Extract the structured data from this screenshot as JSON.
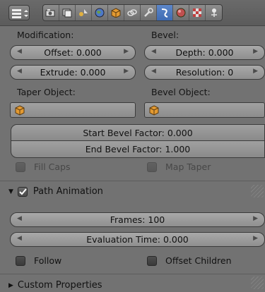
{
  "header": {
    "tabs": [
      "render-icon",
      "render-layers-icon",
      "scene-icon",
      "world-icon",
      "object-icon",
      "constraints-icon",
      "modifiers-icon",
      "curve-data-icon",
      "material-icon",
      "texture-icon",
      "physics-icon"
    ],
    "active_tab": "curve-data-icon",
    "accent_color": "#4a78c0"
  },
  "geometry": {
    "modification_label": "Modification:",
    "bevel_label": "Bevel:",
    "offset": "Offset: 0.000",
    "extrude": "Extrude: 0.000",
    "depth": "Depth: 0.000",
    "resolution": "Resolution: 0",
    "taper_object_label": "Taper Object:",
    "bevel_object_label": "Bevel Object:",
    "start_bevel_factor": "Start Bevel Factor: 0.000",
    "end_bevel_factor": "End Bevel Factor: 1.000",
    "fill_caps": "Fill Caps",
    "map_taper": "Map Taper"
  },
  "path_animation": {
    "title": "Path Animation",
    "enabled": true,
    "frames": "Frames: 100",
    "evaluation_time": "Evaluation Time: 0.000",
    "follow": "Follow",
    "offset_children": "Offset Children"
  },
  "custom_properties": {
    "title": "Custom Properties"
  }
}
